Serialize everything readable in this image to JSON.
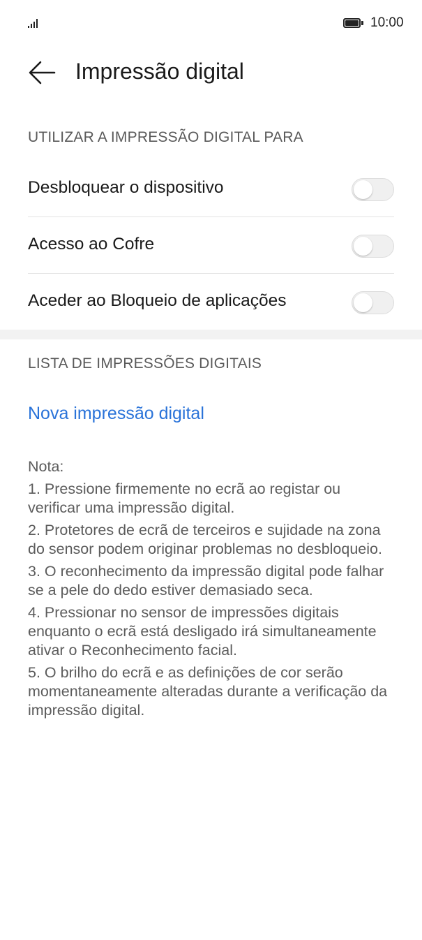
{
  "status_bar": {
    "signal_icon": "cellular-signal-icon",
    "battery_icon": "battery-full-icon",
    "time": "10:00"
  },
  "header": {
    "back_icon": "arrow-left-icon",
    "title": "Impressão digital"
  },
  "section_use": {
    "title": "UTILIZAR A IMPRESSÃO DIGITAL PARA",
    "items": [
      {
        "label": "Desbloquear o dispositivo",
        "enabled": false
      },
      {
        "label": "Acesso ao Cofre",
        "enabled": false
      },
      {
        "label": "Aceder ao Bloqueio de aplicações",
        "enabled": false
      }
    ]
  },
  "section_list": {
    "title": "LISTA DE IMPRESSÕES DIGITAIS",
    "new_fingerprint_label": "Nova impressão digital"
  },
  "notes": {
    "heading": "Nota:",
    "items": [
      "1. Pressione firmemente no ecrã ao registar ou verificar uma impressão digital.",
      "2. Protetores de ecrã de terceiros e sujidade na zona do sensor podem originar problemas no desbloqueio.",
      "3. O reconhecimento da impressão digital pode falhar se a pele do dedo estiver demasiado seca.",
      "4. Pressionar no sensor de impressões digitais enquanto o ecrã está desligado irá simultaneamente ativar o Reconhecimento facial.",
      "5. O brilho do ecrã e as definições de cor serão momentaneamente alteradas durante a verificação da impressão digital."
    ]
  },
  "colors": {
    "accent": "#2a73d9",
    "section_header": "#5a5a5a",
    "toggle_off": "#f0f0f0"
  }
}
